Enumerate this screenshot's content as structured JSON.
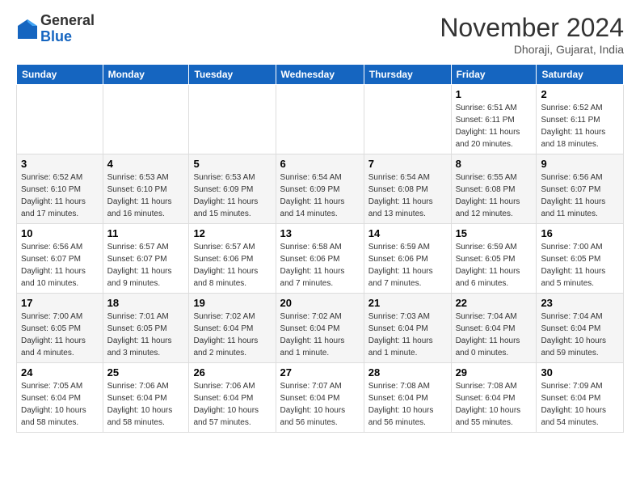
{
  "header": {
    "logo_line1": "General",
    "logo_line2": "Blue",
    "month_title": "November 2024",
    "location": "Dhoraji, Gujarat, India"
  },
  "days_of_week": [
    "Sunday",
    "Monday",
    "Tuesday",
    "Wednesday",
    "Thursday",
    "Friday",
    "Saturday"
  ],
  "weeks": [
    [
      {
        "day": "",
        "info": ""
      },
      {
        "day": "",
        "info": ""
      },
      {
        "day": "",
        "info": ""
      },
      {
        "day": "",
        "info": ""
      },
      {
        "day": "",
        "info": ""
      },
      {
        "day": "1",
        "info": "Sunrise: 6:51 AM\nSunset: 6:11 PM\nDaylight: 11 hours\nand 20 minutes."
      },
      {
        "day": "2",
        "info": "Sunrise: 6:52 AM\nSunset: 6:11 PM\nDaylight: 11 hours\nand 18 minutes."
      }
    ],
    [
      {
        "day": "3",
        "info": "Sunrise: 6:52 AM\nSunset: 6:10 PM\nDaylight: 11 hours\nand 17 minutes."
      },
      {
        "day": "4",
        "info": "Sunrise: 6:53 AM\nSunset: 6:10 PM\nDaylight: 11 hours\nand 16 minutes."
      },
      {
        "day": "5",
        "info": "Sunrise: 6:53 AM\nSunset: 6:09 PM\nDaylight: 11 hours\nand 15 minutes."
      },
      {
        "day": "6",
        "info": "Sunrise: 6:54 AM\nSunset: 6:09 PM\nDaylight: 11 hours\nand 14 minutes."
      },
      {
        "day": "7",
        "info": "Sunrise: 6:54 AM\nSunset: 6:08 PM\nDaylight: 11 hours\nand 13 minutes."
      },
      {
        "day": "8",
        "info": "Sunrise: 6:55 AM\nSunset: 6:08 PM\nDaylight: 11 hours\nand 12 minutes."
      },
      {
        "day": "9",
        "info": "Sunrise: 6:56 AM\nSunset: 6:07 PM\nDaylight: 11 hours\nand 11 minutes."
      }
    ],
    [
      {
        "day": "10",
        "info": "Sunrise: 6:56 AM\nSunset: 6:07 PM\nDaylight: 11 hours\nand 10 minutes."
      },
      {
        "day": "11",
        "info": "Sunrise: 6:57 AM\nSunset: 6:07 PM\nDaylight: 11 hours\nand 9 minutes."
      },
      {
        "day": "12",
        "info": "Sunrise: 6:57 AM\nSunset: 6:06 PM\nDaylight: 11 hours\nand 8 minutes."
      },
      {
        "day": "13",
        "info": "Sunrise: 6:58 AM\nSunset: 6:06 PM\nDaylight: 11 hours\nand 7 minutes."
      },
      {
        "day": "14",
        "info": "Sunrise: 6:59 AM\nSunset: 6:06 PM\nDaylight: 11 hours\nand 7 minutes."
      },
      {
        "day": "15",
        "info": "Sunrise: 6:59 AM\nSunset: 6:05 PM\nDaylight: 11 hours\nand 6 minutes."
      },
      {
        "day": "16",
        "info": "Sunrise: 7:00 AM\nSunset: 6:05 PM\nDaylight: 11 hours\nand 5 minutes."
      }
    ],
    [
      {
        "day": "17",
        "info": "Sunrise: 7:00 AM\nSunset: 6:05 PM\nDaylight: 11 hours\nand 4 minutes."
      },
      {
        "day": "18",
        "info": "Sunrise: 7:01 AM\nSunset: 6:05 PM\nDaylight: 11 hours\nand 3 minutes."
      },
      {
        "day": "19",
        "info": "Sunrise: 7:02 AM\nSunset: 6:04 PM\nDaylight: 11 hours\nand 2 minutes."
      },
      {
        "day": "20",
        "info": "Sunrise: 7:02 AM\nSunset: 6:04 PM\nDaylight: 11 hours\nand 1 minute."
      },
      {
        "day": "21",
        "info": "Sunrise: 7:03 AM\nSunset: 6:04 PM\nDaylight: 11 hours\nand 1 minute."
      },
      {
        "day": "22",
        "info": "Sunrise: 7:04 AM\nSunset: 6:04 PM\nDaylight: 11 hours\nand 0 minutes."
      },
      {
        "day": "23",
        "info": "Sunrise: 7:04 AM\nSunset: 6:04 PM\nDaylight: 10 hours\nand 59 minutes."
      }
    ],
    [
      {
        "day": "24",
        "info": "Sunrise: 7:05 AM\nSunset: 6:04 PM\nDaylight: 10 hours\nand 58 minutes."
      },
      {
        "day": "25",
        "info": "Sunrise: 7:06 AM\nSunset: 6:04 PM\nDaylight: 10 hours\nand 58 minutes."
      },
      {
        "day": "26",
        "info": "Sunrise: 7:06 AM\nSunset: 6:04 PM\nDaylight: 10 hours\nand 57 minutes."
      },
      {
        "day": "27",
        "info": "Sunrise: 7:07 AM\nSunset: 6:04 PM\nDaylight: 10 hours\nand 56 minutes."
      },
      {
        "day": "28",
        "info": "Sunrise: 7:08 AM\nSunset: 6:04 PM\nDaylight: 10 hours\nand 56 minutes."
      },
      {
        "day": "29",
        "info": "Sunrise: 7:08 AM\nSunset: 6:04 PM\nDaylight: 10 hours\nand 55 minutes."
      },
      {
        "day": "30",
        "info": "Sunrise: 7:09 AM\nSunset: 6:04 PM\nDaylight: 10 hours\nand 54 minutes."
      }
    ]
  ]
}
